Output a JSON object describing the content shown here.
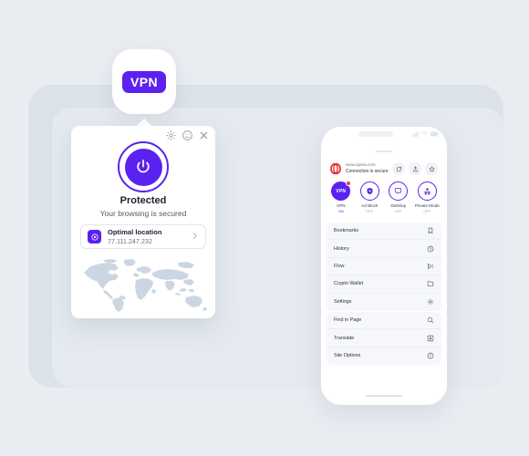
{
  "theme": {
    "background": "#e9edf2",
    "panel_outer": "#dce2ea",
    "panel_inner": "#e5eaf0",
    "accent_purple": "#5b21f0",
    "map_land": "#cdd7e2",
    "opera_red": "#e8232a",
    "badge_red": "#ff2d55",
    "card_white": "#ffffff"
  },
  "app_tile": {
    "label": "VPN",
    "icon": "vpn-app-icon"
  },
  "vpn_popup": {
    "titlebar": {
      "settings_icon": "gear-icon",
      "feedback_icon": "smiley-icon",
      "close_icon": "close-icon"
    },
    "power_button": {
      "icon": "power-icon",
      "state": "on"
    },
    "status_title": "Protected",
    "status_subtitle": "Your browsing is secured",
    "location_card": {
      "icon": "globe-location-icon",
      "name": "Optimal location",
      "ip": "77.111.247.232",
      "chevron": "chevron-right-icon"
    },
    "map_icon": "world-map"
  },
  "phone": {
    "status_bar": {
      "notch": "camera-notch",
      "signal_icon": "signal-bars-icon",
      "wifi_icon": "wifi-icon",
      "battery_icon": "battery-icon"
    },
    "address_bar": {
      "logo": "opera-logo-icon",
      "url": "www.opera.com",
      "security_text": "Connection is secure",
      "actions": [
        {
          "name": "reload-button",
          "icon": "reload-icon"
        },
        {
          "name": "share-button",
          "icon": "share-icon"
        },
        {
          "name": "bookmark-button",
          "icon": "star-icon"
        }
      ]
    },
    "quick_actions": [
      {
        "label": "VPN",
        "state": "ON",
        "enabled": true,
        "icon": "vpn-toggle-icon",
        "badge": true
      },
      {
        "label": "Ad Block",
        "state": "OFF",
        "enabled": false,
        "icon": "adblock-shield-icon",
        "badge": false
      },
      {
        "label": "Desktop",
        "state": "OFF",
        "enabled": false,
        "icon": "desktop-monitor-icon",
        "badge": false
      },
      {
        "label": "Private Mode",
        "state": "OFF",
        "enabled": false,
        "icon": "private-mask-icon",
        "badge": false
      }
    ],
    "menu_group_1": [
      {
        "label": "Bookmarks",
        "icon": "bookmark-icon"
      },
      {
        "label": "History",
        "icon": "clock-icon"
      },
      {
        "label": "Flow",
        "icon": "flow-send-icon"
      },
      {
        "label": "Crypto Wallet",
        "icon": "wallet-folder-icon"
      },
      {
        "label": "Settings",
        "icon": "gear-icon"
      }
    ],
    "menu_group_2": [
      {
        "label": "Find in Page",
        "icon": "search-icon"
      },
      {
        "label": "Translate",
        "icon": "translate-icon"
      },
      {
        "label": "Site Options",
        "icon": "info-circle-icon"
      }
    ],
    "home_indicator": "home-indicator"
  }
}
